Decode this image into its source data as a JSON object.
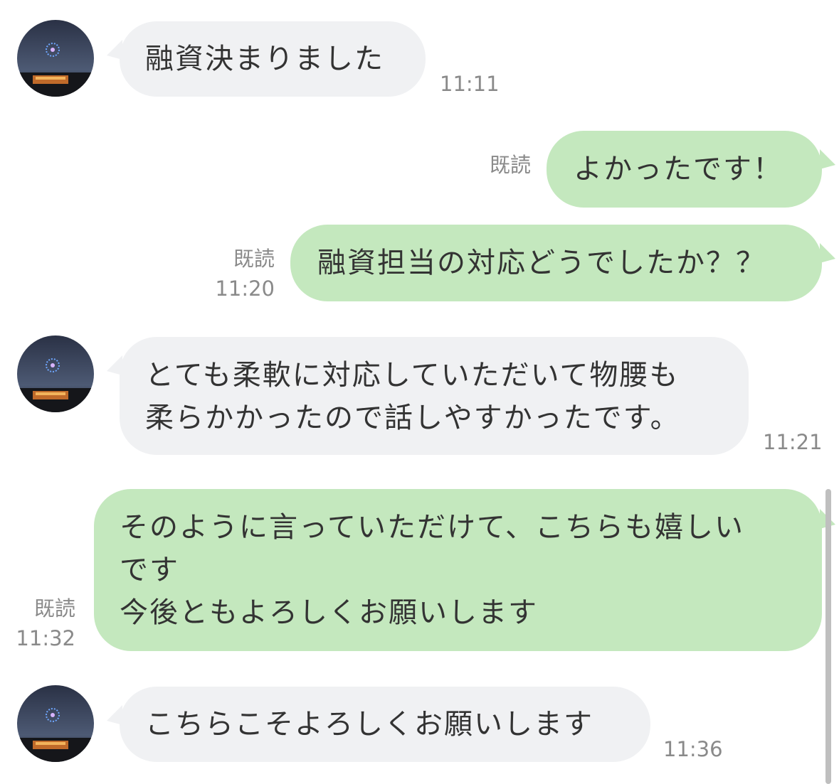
{
  "colors": {
    "incoming_bubble": "#f0f1f3",
    "outgoing_bubble": "#c4e8be",
    "meta_text": "#8a8a8a",
    "message_text": "#333333"
  },
  "avatar_icon": "avatar-night-fireworks",
  "messages": [
    {
      "side": "incoming",
      "lines": [
        "融資決まりました"
      ],
      "time": "11:11"
    },
    {
      "side": "outgoing",
      "lines": [
        "よかったです！"
      ],
      "read": "既読",
      "time": ""
    },
    {
      "side": "outgoing",
      "lines": [
        "融資担当の対応どうでしたか？？"
      ],
      "read": "既読",
      "time": "11:20"
    },
    {
      "side": "incoming",
      "lines": [
        "とても柔軟に対応していただいて物腰も",
        "柔らかかったので話しやすかったです。"
      ],
      "time": "11:21"
    },
    {
      "side": "outgoing",
      "lines": [
        "そのように言っていただけて、こちらも嬉しい",
        "です",
        "今後ともよろしくお願いします"
      ],
      "read": "既読",
      "time": "11:32"
    },
    {
      "side": "incoming",
      "lines": [
        "こちらこそよろしくお願いします"
      ],
      "time": "11:36"
    }
  ]
}
